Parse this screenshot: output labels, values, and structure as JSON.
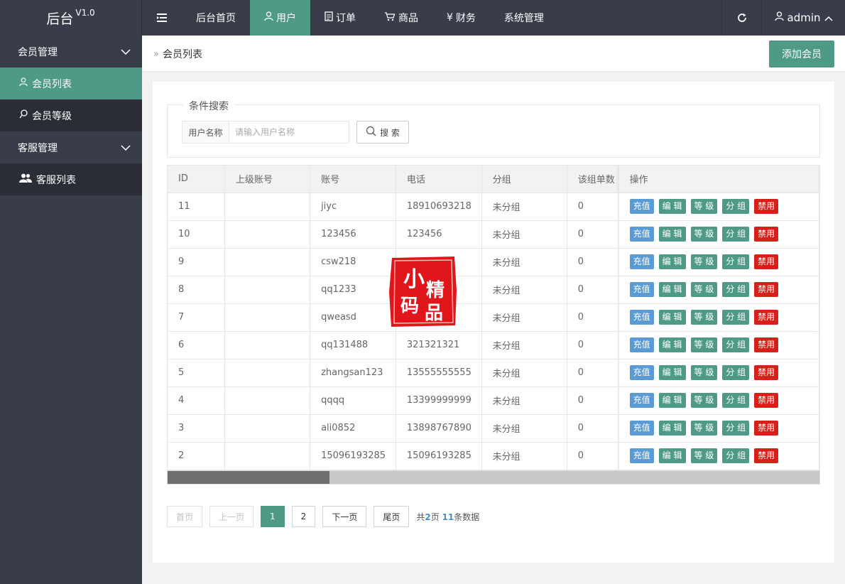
{
  "header": {
    "logo_name": "后台",
    "logo_version": "V1.0",
    "nav": [
      {
        "label": "后台首页",
        "icon": ""
      },
      {
        "label": "用户",
        "icon": "user-icon"
      },
      {
        "label": "订单",
        "icon": "document-icon"
      },
      {
        "label": "商品",
        "icon": "cart-icon"
      },
      {
        "label": "财务",
        "icon": "yen-icon"
      },
      {
        "label": "系统管理",
        "icon": ""
      }
    ],
    "active_nav": "用户",
    "username": "admin"
  },
  "sidebar": {
    "groups": [
      {
        "label": "会员管理",
        "items": [
          {
            "label": "会员列表",
            "icon": "user-icon"
          },
          {
            "label": "会员等级",
            "icon": "badge-icon"
          }
        ]
      },
      {
        "label": "客服管理",
        "items": [
          {
            "label": "客服列表",
            "icon": "users-icon"
          }
        ]
      }
    ],
    "active_item": "会员列表"
  },
  "breadcrumb": "会员列表",
  "add_button": "添加会员",
  "search": {
    "legend": "条件搜索",
    "label": "用户名称",
    "placeholder": "请输入用户名称",
    "value": "",
    "button": "搜 索"
  },
  "table": {
    "columns": [
      "ID",
      "上级账号",
      "账号",
      "电话",
      "分组",
      "该组单数",
      "操作"
    ],
    "actions": [
      "充值",
      "编 辑",
      "等 级",
      "分 组",
      "禁用"
    ],
    "rows": [
      {
        "id": "11",
        "parent": "",
        "account": "jiyc",
        "phone": "18910693218",
        "group": "未分组",
        "count": "0"
      },
      {
        "id": "10",
        "parent": "",
        "account": "123456",
        "phone": "123456",
        "group": "未分组",
        "count": "0"
      },
      {
        "id": "9",
        "parent": "",
        "account": "csw218",
        "phone": "",
        "group": "未分组",
        "count": "0"
      },
      {
        "id": "8",
        "parent": "",
        "account": "qq1233",
        "phone": "",
        "group": "未分组",
        "count": "0"
      },
      {
        "id": "7",
        "parent": "",
        "account": "qweasd",
        "phone": "",
        "group": "未分组",
        "count": "0"
      },
      {
        "id": "6",
        "parent": "",
        "account": "qq131488",
        "phone": "321321321",
        "group": "未分组",
        "count": "0"
      },
      {
        "id": "5",
        "parent": "",
        "account": "zhangsan123",
        "phone": "13555555555",
        "group": "未分组",
        "count": "0"
      },
      {
        "id": "4",
        "parent": "",
        "account": "qqqq",
        "phone": "13399999999",
        "group": "未分组",
        "count": "0"
      },
      {
        "id": "3",
        "parent": "",
        "account": "ali0852",
        "phone": "13898767890",
        "group": "未分组",
        "count": "0"
      },
      {
        "id": "2",
        "parent": "",
        "account": "15096193285",
        "phone": "15096193285",
        "group": "未分组",
        "count": "0"
      }
    ],
    "scroll_position": 0.25
  },
  "pagination": {
    "first": "首页",
    "prev": "上一页",
    "pages": [
      "1",
      "2"
    ],
    "current": "1",
    "next": "下一页",
    "last": "尾页",
    "info_prefix": "共",
    "total_pages": "2",
    "info_mid": "页 ",
    "total_records": "11",
    "info_suffix": "条数据"
  },
  "watermark": {
    "text": "小码精品",
    "color": "#e0161b"
  },
  "colors": {
    "header_bg": "#393d49",
    "accent": "#4e9a87",
    "recharge": "#5b9bd5",
    "ban": "#d6211a"
  }
}
